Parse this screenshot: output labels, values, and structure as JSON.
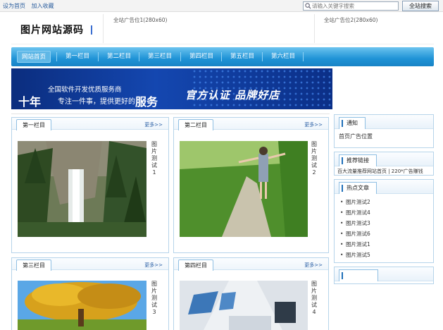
{
  "topbar": {
    "links": [
      "设为首页",
      "加入收藏"
    ]
  },
  "search": {
    "placeholder": "请输入关键字搜索",
    "button": "全站搜索"
  },
  "header": {
    "logo": "图片网站源码",
    "ads": [
      "全站广告位1(280x60)",
      "全站广告位2(280x60)"
    ]
  },
  "nav": {
    "items": [
      "网站首页",
      "第一栏目",
      "第二栏目",
      "第三栏目",
      "第四栏目",
      "第五栏目",
      "第六栏目"
    ]
  },
  "banner": {
    "line1": "全国软件开发优质服务商",
    "years": "十年",
    "line2": "专注一件事，提供更好的",
    "service": "服务",
    "slogan": "官方认证 品牌好店"
  },
  "columns": [
    {
      "title": "第一栏目",
      "more": "更多>>",
      "item": "图片测试1"
    },
    {
      "title": "第二栏目",
      "more": "更多>>",
      "item": "图片测试2"
    },
    {
      "title": "第三栏目",
      "more": "更多>>",
      "item": "图片测试3"
    },
    {
      "title": "第四栏目",
      "more": "更多>>",
      "item": "图片测试4"
    }
  ],
  "sidebar": {
    "notice": {
      "title": "通知",
      "text": "首页广告位置"
    },
    "links": {
      "title": "推荐链接",
      "text": "百大流量推荐网站首页 | 220*广告赚钱"
    },
    "hot": {
      "title": "热点文章",
      "items": [
        "图片测试2",
        "图片测试4",
        "图片测试3",
        "图片测试6",
        "图片测试1",
        "图片测试5"
      ]
    },
    "extra": {
      "title": ""
    }
  },
  "colors": {
    "nav": "#1f93d6",
    "border": "#b6d4ea",
    "banner": "#1447b0",
    "link": "#2b5e9e"
  }
}
